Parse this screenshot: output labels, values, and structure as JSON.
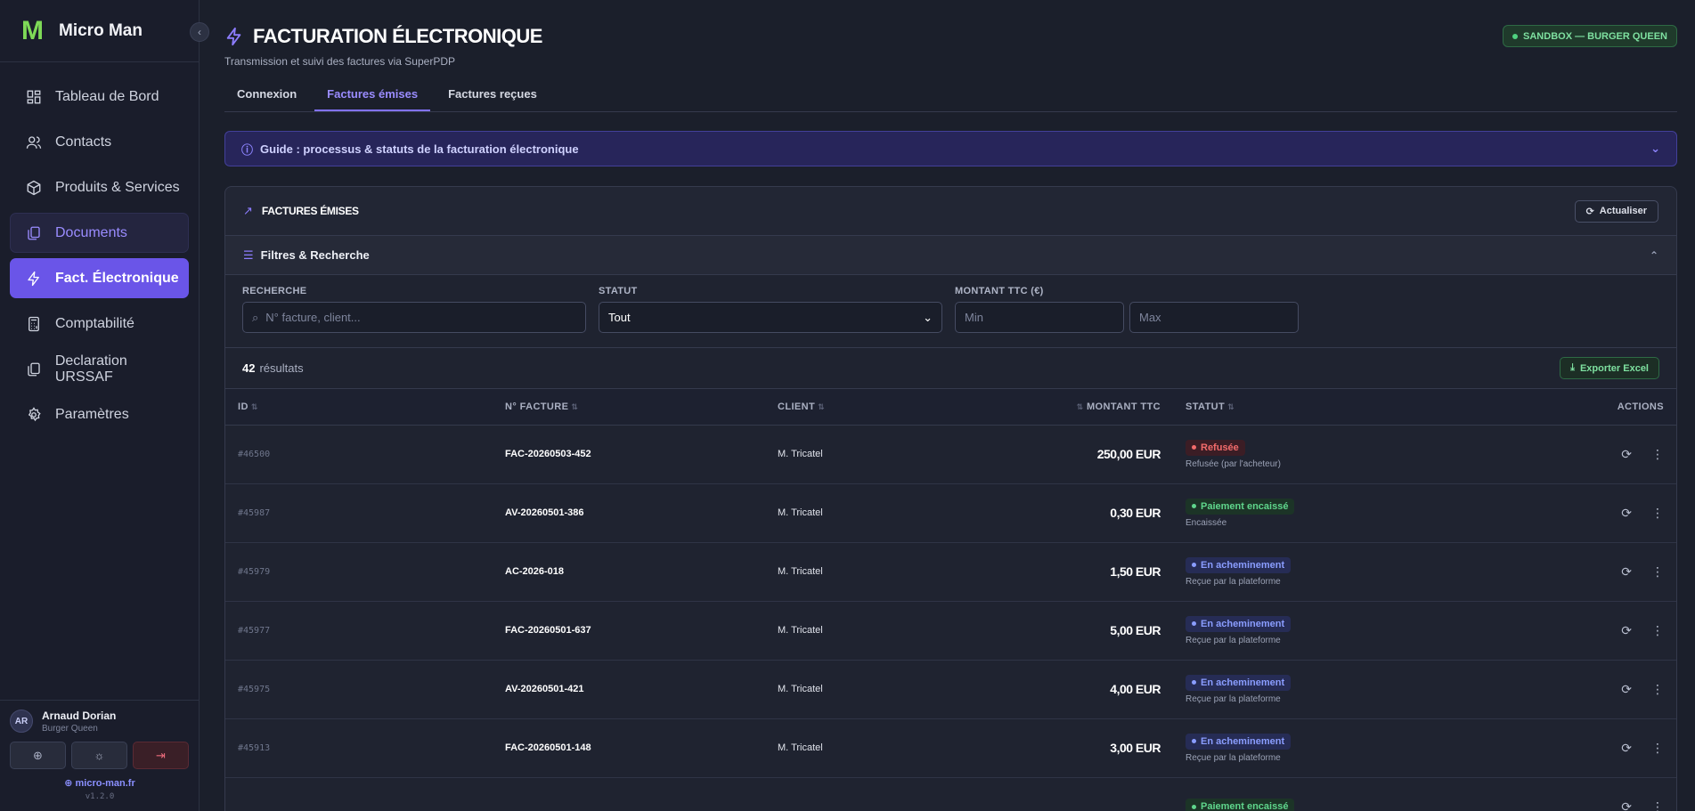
{
  "brand": {
    "logo": "M",
    "name": "Micro Man"
  },
  "nav": [
    {
      "label": "Tableau de Bord",
      "icon": "dashboard-icon",
      "name": "nav-tableau-de-bord",
      "state": ""
    },
    {
      "label": "Contacts",
      "icon": "users-icon",
      "name": "nav-contacts",
      "state": ""
    },
    {
      "label": "Produits & Services",
      "icon": "box-icon",
      "name": "nav-produits-services",
      "state": ""
    },
    {
      "label": "Documents",
      "icon": "files-icon",
      "name": "nav-documents",
      "state": "soft"
    },
    {
      "label": "Fact. Électronique",
      "icon": "bolt-icon",
      "name": "nav-fact-electronique",
      "state": "active"
    },
    {
      "label": "Comptabilité",
      "icon": "calculator-icon",
      "name": "nav-comptabilite",
      "state": ""
    },
    {
      "label": "Declaration URSSAF",
      "icon": "files-icon",
      "name": "nav-declaration-urssaf",
      "state": ""
    },
    {
      "label": "Paramètres",
      "icon": "gear-icon",
      "name": "nav-parametres",
      "state": ""
    }
  ],
  "user": {
    "initials": "AR",
    "name": "Arnaud Dorian",
    "org": "Burger Queen"
  },
  "footer": {
    "site": "micro-man.fr",
    "version": "v1.2.0"
  },
  "header": {
    "title": "FACTURATION ÉLECTRONIQUE",
    "subtitle": "Transmission et suivi des factures via SuperPDP",
    "sandbox": "SANDBOX — BURGER QUEEN"
  },
  "tabs": [
    {
      "label": "Connexion",
      "active": false
    },
    {
      "label": "Factures émises",
      "active": true
    },
    {
      "label": "Factures reçues",
      "active": false
    }
  ],
  "guide": {
    "label": "Guide : processus & statuts de la facturation électronique"
  },
  "card": {
    "title": "FACTURES ÉMISES",
    "refresh_label": "Actualiser"
  },
  "filters": {
    "title": "Filtres & Recherche",
    "search_label": "RECHERCHE",
    "search_placeholder": "N° facture, client...",
    "status_label": "STATUT",
    "status_value": "Tout",
    "amount_label": "MONTANT TTC (€)",
    "min_placeholder": "Min",
    "max_placeholder": "Max"
  },
  "results": {
    "count": "42",
    "label": "résultats",
    "export_label": "Exporter Excel"
  },
  "table": {
    "headers": {
      "id": "ID",
      "num": "N° FACTURE",
      "client": "CLIENT",
      "amount": "MONTANT TTC",
      "status": "STATUT",
      "actions": "ACTIONS"
    },
    "rows": [
      {
        "id": "#46500",
        "num": "FAC-20260503-452",
        "client": "M. Tricatel",
        "amount": "250,00 EUR",
        "status": "Refusée",
        "sub": "Refusée (par l'acheteur)",
        "kind": "red"
      },
      {
        "id": "#45987",
        "num": "AV-20260501-386",
        "client": "M. Tricatel",
        "amount": "0,30 EUR",
        "status": "Paiement encaissé",
        "sub": "Encaissée",
        "kind": "green"
      },
      {
        "id": "#45979",
        "num": "AC-2026-018",
        "client": "M. Tricatel",
        "amount": "1,50 EUR",
        "status": "En acheminement",
        "sub": "Reçue par la plateforme",
        "kind": "blue"
      },
      {
        "id": "#45977",
        "num": "FAC-20260501-637",
        "client": "M. Tricatel",
        "amount": "5,00 EUR",
        "status": "En acheminement",
        "sub": "Reçue par la plateforme",
        "kind": "blue"
      },
      {
        "id": "#45975",
        "num": "AV-20260501-421",
        "client": "M. Tricatel",
        "amount": "4,00 EUR",
        "status": "En acheminement",
        "sub": "Reçue par la plateforme",
        "kind": "blue"
      },
      {
        "id": "#45913",
        "num": "FAC-20260501-148",
        "client": "M. Tricatel",
        "amount": "3,00 EUR",
        "status": "En acheminement",
        "sub": "Reçue par la plateforme",
        "kind": "blue"
      },
      {
        "id": "",
        "num": "",
        "client": "",
        "amount": "",
        "status": "Paiement encaissé",
        "sub": "",
        "kind": "green"
      }
    ]
  },
  "colors": {
    "accent": "#6a55e8",
    "red": "#f26b6b",
    "green": "#5fd68c",
    "blue": "#8a9dff"
  }
}
